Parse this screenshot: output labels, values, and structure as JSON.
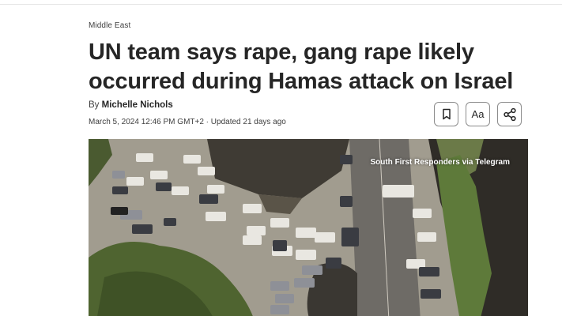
{
  "article": {
    "section": "Middle East",
    "headline": "UN team says rape, gang rape likely occurred during Hamas attack on Israel",
    "byline_prefix": "By",
    "author": "Michelle Nichols",
    "dateline": "March 5, 2024 12:46 PM GMT+2 · Updated 21 days ago"
  },
  "tools": {
    "bookmark_icon": "bookmark-icon",
    "text_size_label": "Aa",
    "share_icon": "share-icon"
  },
  "image": {
    "credit": "South First Responders via Telegram"
  },
  "colors": {
    "text": "#262626",
    "muted": "#404040",
    "border": "#8c8c8c"
  }
}
